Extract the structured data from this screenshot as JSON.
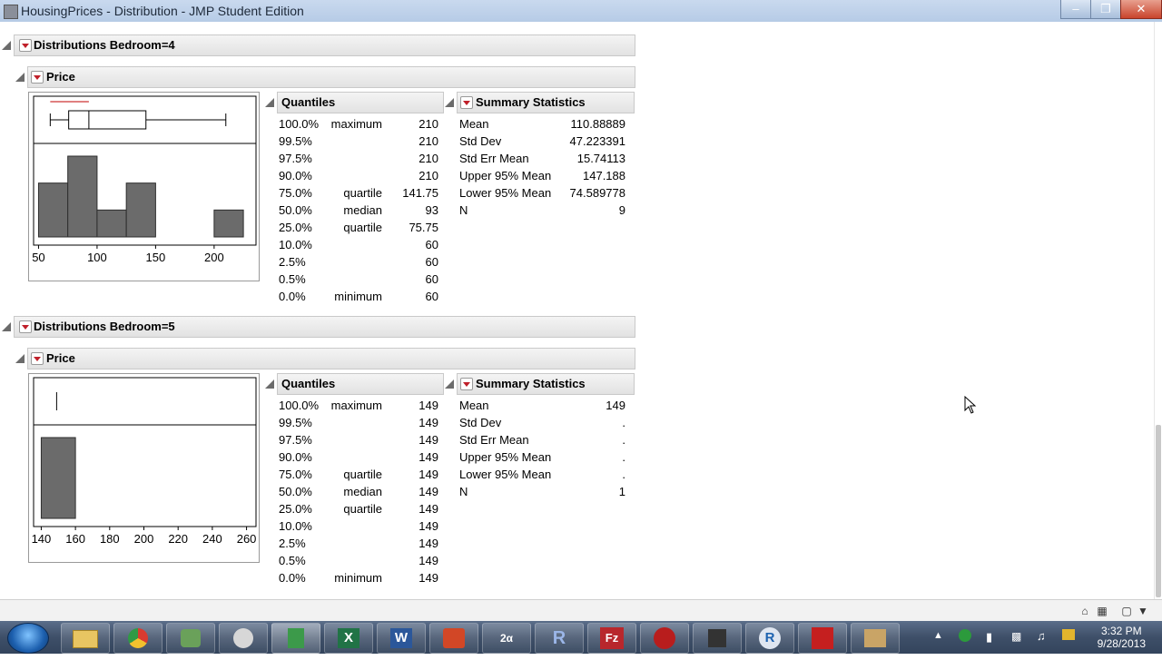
{
  "window": {
    "title": "HousingPrices - Distribution - JMP Student Edition"
  },
  "sections": [
    {
      "title": "Distributions Bedroom=4",
      "variable": "Price",
      "hist_axis": [
        "50",
        "100",
        "150",
        "200"
      ],
      "quantiles_title": "Quantiles",
      "quantiles": [
        {
          "pct": "100.0%",
          "label": "maximum",
          "value": "210"
        },
        {
          "pct": "99.5%",
          "label": "",
          "value": "210"
        },
        {
          "pct": "97.5%",
          "label": "",
          "value": "210"
        },
        {
          "pct": "90.0%",
          "label": "",
          "value": "210"
        },
        {
          "pct": "75.0%",
          "label": "quartile",
          "value": "141.75"
        },
        {
          "pct": "50.0%",
          "label": "median",
          "value": "93"
        },
        {
          "pct": "25.0%",
          "label": "quartile",
          "value": "75.75"
        },
        {
          "pct": "10.0%",
          "label": "",
          "value": "60"
        },
        {
          "pct": "2.5%",
          "label": "",
          "value": "60"
        },
        {
          "pct": "0.5%",
          "label": "",
          "value": "60"
        },
        {
          "pct": "0.0%",
          "label": "minimum",
          "value": "60"
        }
      ],
      "summary_title": "Summary Statistics",
      "summary": [
        {
          "label": "Mean",
          "value": "110.88889"
        },
        {
          "label": "Std Dev",
          "value": "47.223391"
        },
        {
          "label": "Std Err Mean",
          "value": "15.74113"
        },
        {
          "label": "Upper 95% Mean",
          "value": "147.188"
        },
        {
          "label": "Lower 95% Mean",
          "value": "74.589778"
        },
        {
          "label": "N",
          "value": "9"
        }
      ]
    },
    {
      "title": "Distributions Bedroom=5",
      "variable": "Price",
      "hist_axis": [
        "140",
        "160",
        "180",
        "200",
        "220",
        "240",
        "260"
      ],
      "quantiles_title": "Quantiles",
      "quantiles": [
        {
          "pct": "100.0%",
          "label": "maximum",
          "value": "149"
        },
        {
          "pct": "99.5%",
          "label": "",
          "value": "149"
        },
        {
          "pct": "97.5%",
          "label": "",
          "value": "149"
        },
        {
          "pct": "90.0%",
          "label": "",
          "value": "149"
        },
        {
          "pct": "75.0%",
          "label": "quartile",
          "value": "149"
        },
        {
          "pct": "50.0%",
          "label": "median",
          "value": "149"
        },
        {
          "pct": "25.0%",
          "label": "quartile",
          "value": "149"
        },
        {
          "pct": "10.0%",
          "label": "",
          "value": "149"
        },
        {
          "pct": "2.5%",
          "label": "",
          "value": "149"
        },
        {
          "pct": "0.5%",
          "label": "",
          "value": "149"
        },
        {
          "pct": "0.0%",
          "label": "minimum",
          "value": "149"
        }
      ],
      "summary_title": "Summary Statistics",
      "summary": [
        {
          "label": "Mean",
          "value": "149"
        },
        {
          "label": "Std Dev",
          "value": "."
        },
        {
          "label": "Std Err Mean",
          "value": "."
        },
        {
          "label": "Upper 95% Mean",
          "value": "."
        },
        {
          "label": "Lower 95% Mean",
          "value": "."
        },
        {
          "label": "N",
          "value": "1"
        }
      ]
    }
  ],
  "chart_data": [
    {
      "type": "bar",
      "x_ticks": [
        50,
        100,
        150,
        200
      ],
      "xlim": [
        45,
        235
      ],
      "bins": [
        [
          50,
          75
        ],
        [
          75,
          100
        ],
        [
          100,
          125
        ],
        [
          125,
          150
        ],
        [
          200,
          225
        ]
      ],
      "counts": [
        2,
        3,
        1,
        2,
        1
      ],
      "boxplot": {
        "min": 60,
        "q1": 75.75,
        "median": 93,
        "q3": 141.75,
        "max": 210
      }
    },
    {
      "type": "bar",
      "x_ticks": [
        140,
        160,
        180,
        200,
        220,
        240,
        260
      ],
      "xlim": [
        135,
        265
      ],
      "bins": [
        [
          140,
          160
        ]
      ],
      "counts": [
        1
      ],
      "boxplot": {
        "min": 149,
        "q1": 149,
        "median": 149,
        "q3": 149,
        "max": 149
      }
    }
  ],
  "taskbar": {
    "items": [
      "folder-icon",
      "chrome-icon",
      "jmp-icon",
      "sharp-icon",
      "jmp-student-icon",
      "excel-icon",
      "word-icon",
      "powerpoint-icon",
      "math-icon",
      "r-studio-icon",
      "filezilla-icon",
      "media-icon",
      "camtasia-icon",
      "r-icon",
      "acrobat-icon",
      "tools-icon"
    ],
    "labels": {
      "excel": "X",
      "word": "W",
      "rstudio": "R",
      "filezilla": "Fz",
      "r": "R",
      "math": "2α"
    }
  },
  "clock": {
    "time": "3:32 PM",
    "date": "9/28/2013"
  }
}
